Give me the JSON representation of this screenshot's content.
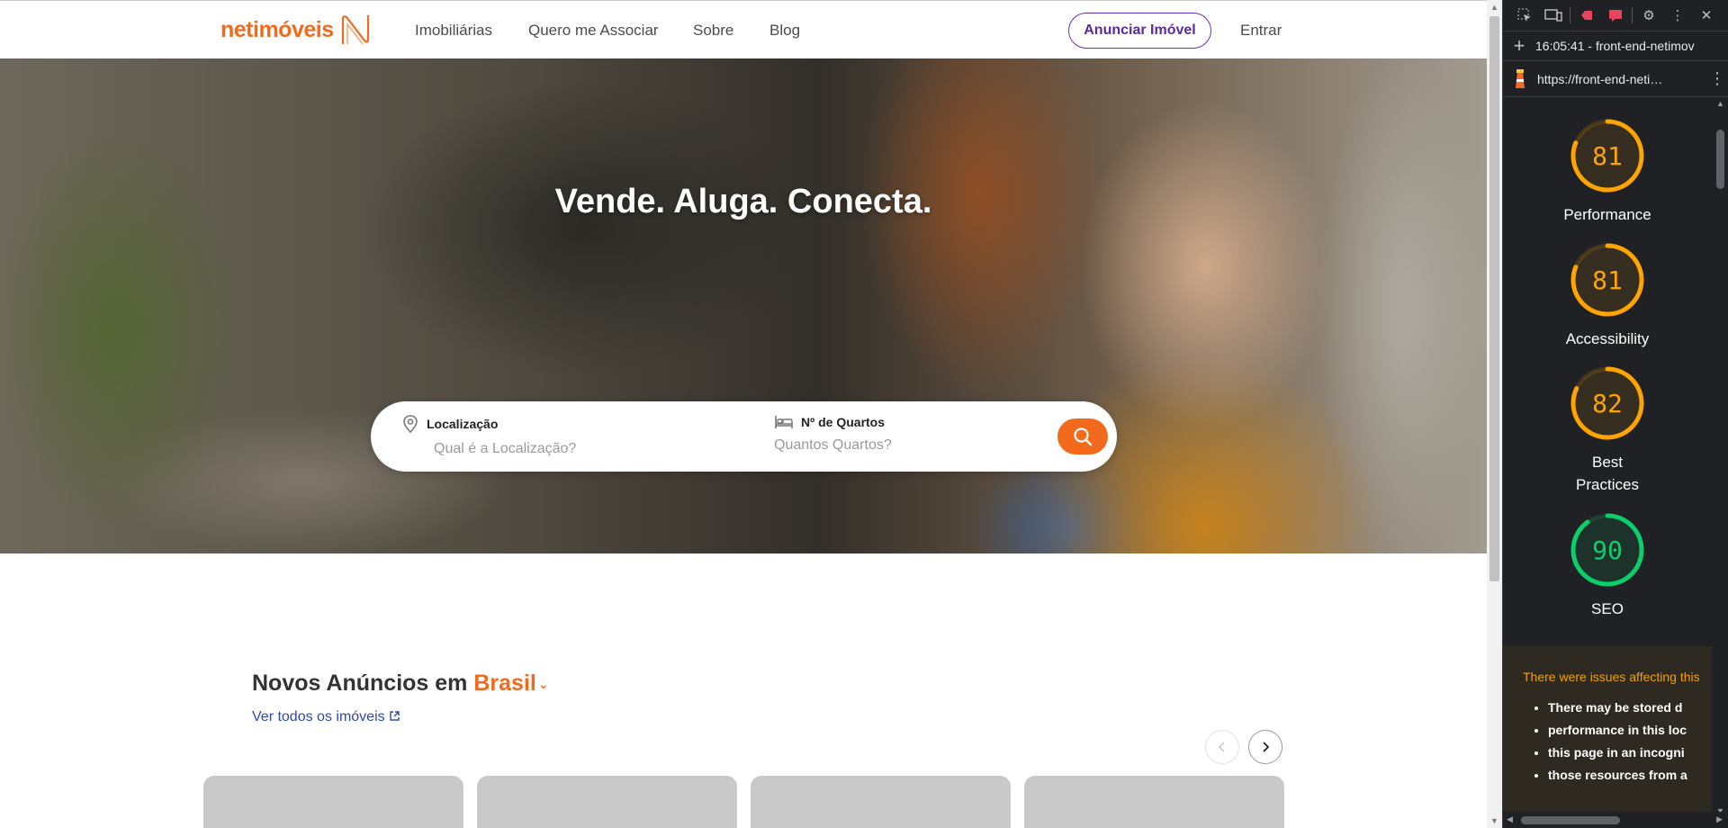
{
  "brand": {
    "name": "netimóveis",
    "color": "#f26b1d",
    "accent": "#5b2a9e"
  },
  "nav": {
    "links": [
      "Imobiliárias",
      "Quero me Associar",
      "Sobre",
      "Blog"
    ],
    "cta_label": "Anunciar Imóvel",
    "login_label": "Entrar"
  },
  "hero": {
    "title": "Vende. Aluga. Conecta.",
    "search": {
      "location_label": "Localização",
      "location_placeholder": "Qual é a Localização?",
      "rooms_label": "Nº de Quartos",
      "rooms_placeholder": "Quantos Quartos?",
      "button_icon": "search-icon"
    }
  },
  "listings": {
    "heading_prefix": "Novos Anúncios em",
    "city": "Brasil",
    "see_all_label": "Ver todos os imóveis",
    "card_count": 4
  },
  "devtools": {
    "timestamp_label": "16:05:41 - front-end-netimov",
    "url": "https://front-end-neti…",
    "scores": [
      {
        "name": "Performance",
        "score": 81,
        "color": "#ffa400"
      },
      {
        "name": "Accessibility",
        "score": 81,
        "color": "#ffa400"
      },
      {
        "name": "Best Practices",
        "score": 82,
        "color": "#ffa400"
      },
      {
        "name": "SEO",
        "score": 90,
        "color": "#0cce6b"
      }
    ],
    "issues": {
      "title": "There were issues affecting this",
      "lines": [
        "There may be stored d",
        "performance in this loc",
        "this page in an incogni",
        "those resources from a"
      ]
    }
  }
}
